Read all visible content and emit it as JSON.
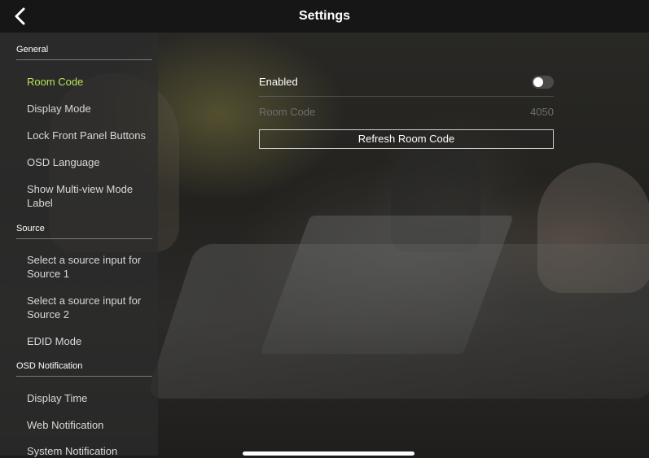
{
  "header": {
    "title": "Settings",
    "back_icon": "chevron-left-icon"
  },
  "sidebar": {
    "sections": [
      {
        "title": "General",
        "items": [
          "Room Code",
          "Display Mode",
          "Lock Front Panel Buttons",
          "OSD Language",
          "Show Multi-view Mode Label"
        ]
      },
      {
        "title": "Source",
        "items": [
          "Select a source input for Source 1",
          "Select a source input for Source 2",
          "EDID Mode"
        ]
      },
      {
        "title": "OSD Notification",
        "items": [
          "Display Time",
          "Web Notification",
          "System Notification"
        ]
      }
    ],
    "active_item": "Room Code"
  },
  "main": {
    "enabled_label": "Enabled",
    "enabled_value": false,
    "room_code_label": "Room Code",
    "room_code_value": "4050",
    "refresh_button": "Refresh Room Code"
  },
  "colors": {
    "accent": "#b5e35a",
    "topbar": "#161616"
  }
}
